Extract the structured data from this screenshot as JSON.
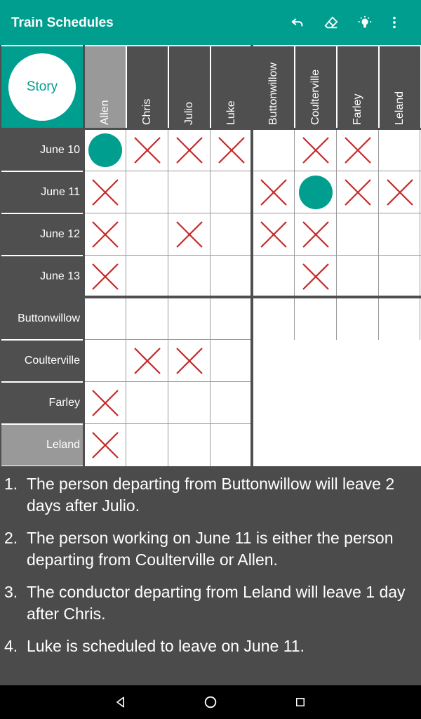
{
  "app": {
    "title": "Train Schedules"
  },
  "toolbar": {
    "undo": "undo-icon",
    "eraser": "eraser-icon",
    "hint": "lightbulb-icon",
    "more": "more-vert-icon"
  },
  "story_button": "Story",
  "columns_people": [
    "Allen",
    "Chris",
    "Julio",
    "Luke"
  ],
  "columns_stations": [
    "Buttonwillow",
    "Coulterville",
    "Farley",
    "Leland"
  ],
  "rows_dates": [
    "June 10",
    "June 11",
    "June 12",
    "June 13"
  ],
  "rows_stations": [
    "Buttonwillow",
    "Coulterville",
    "Farley",
    "Leland"
  ],
  "highlighted": {
    "column": "Allen",
    "row": "Leland"
  },
  "grid_dates_people": [
    [
      "O",
      "X",
      "X",
      "X"
    ],
    [
      "X",
      "",
      "",
      ""
    ],
    [
      "X",
      "",
      "X",
      ""
    ],
    [
      "X",
      "",
      "",
      ""
    ]
  ],
  "grid_dates_stations": [
    [
      "",
      "X",
      "X",
      ""
    ],
    [
      "X",
      "O",
      "X",
      "X"
    ],
    [
      "X",
      "X",
      "",
      ""
    ],
    [
      "",
      "X",
      "",
      ""
    ]
  ],
  "grid_stations_people": [
    [
      "",
      "",
      "",
      ""
    ],
    [
      "",
      "X",
      "X",
      ""
    ],
    [
      "X",
      "",
      "",
      ""
    ],
    [
      "X",
      "",
      "",
      ""
    ]
  ],
  "clues": [
    {
      "num": "1.",
      "text": "The person departing from Buttonwillow will leave 2 days after Julio."
    },
    {
      "num": "2.",
      "text": "The person working on June 11 is either the person departing from Coulterville or Allen."
    },
    {
      "num": "3.",
      "text": "The conductor departing from Leland will leave 1 day after Chris."
    },
    {
      "num": "4.",
      "text": "Luke is scheduled to leave on June 11."
    }
  ],
  "navbar": {
    "back": "back-triangle-icon",
    "home": "home-circle-icon",
    "recents": "recents-square-icon"
  },
  "colors": {
    "accent": "#009e8e",
    "header": "#4f4f4f",
    "highlight": "#999999",
    "cross": "#c62828"
  }
}
